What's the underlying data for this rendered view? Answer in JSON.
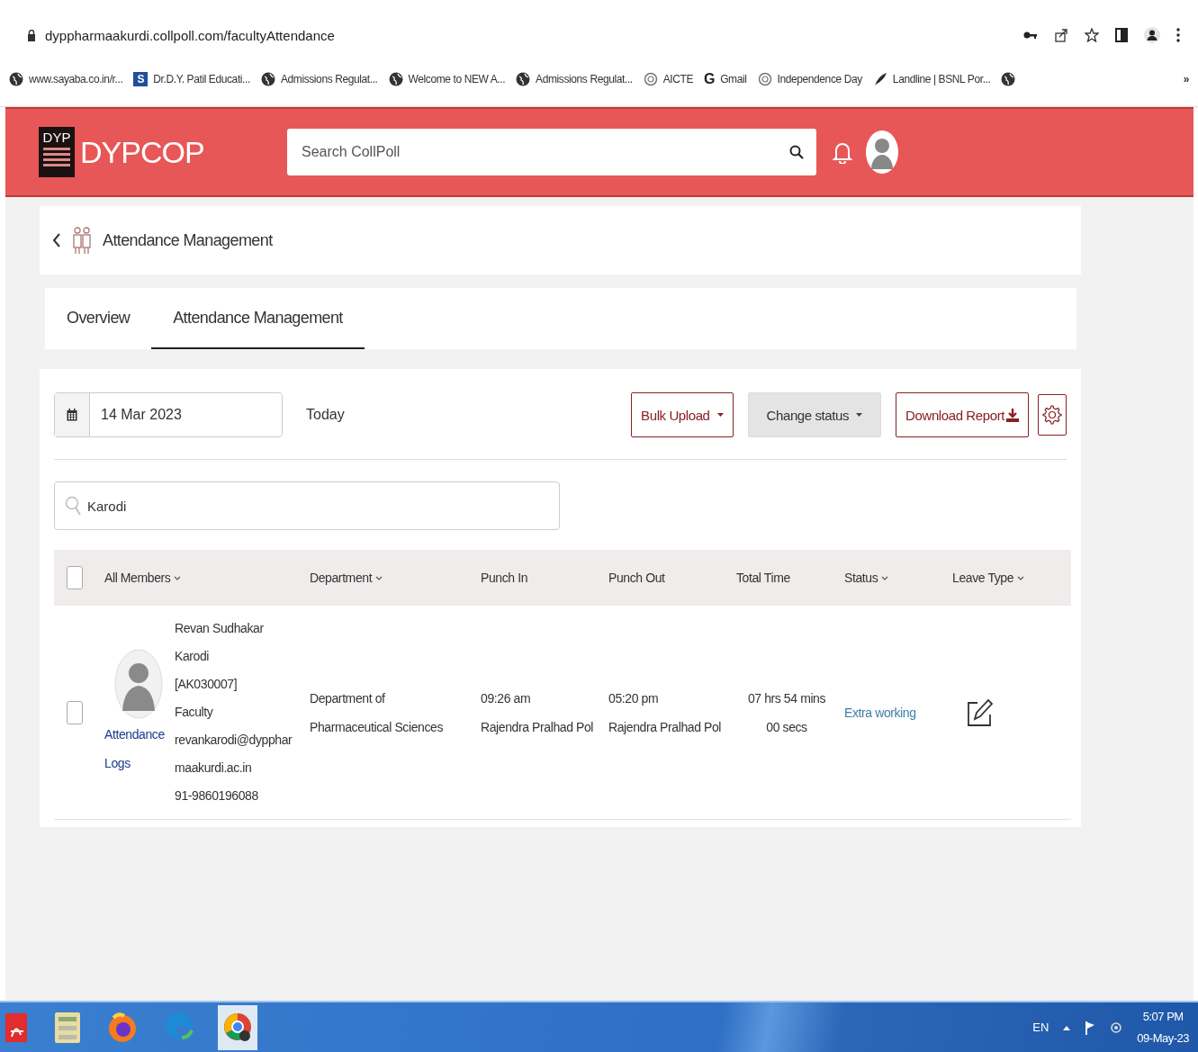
{
  "browser": {
    "url": "dyppharmaakurdi.collpoll.com/facultyAttendance",
    "bookmarks": [
      {
        "label": "www.sayaba.co.in/r...",
        "kind": "globe"
      },
      {
        "label": "Dr.D.Y. Patil Educati...",
        "kind": "letter",
        "letter": "S"
      },
      {
        "label": "Admissions Regulat...",
        "kind": "globe"
      },
      {
        "label": "Welcome to NEW A...",
        "kind": "globe"
      },
      {
        "label": "Admissions Regulat...",
        "kind": "globe"
      },
      {
        "label": "AICTE",
        "kind": "emblem"
      },
      {
        "label": "Gmail",
        "kind": "letter",
        "letter": "G"
      },
      {
        "label": "Independence Day",
        "kind": "emblem"
      },
      {
        "label": "Landline | BSNL Por...",
        "kind": "feather"
      },
      {
        "kind": "globe"
      }
    ],
    "more": "»"
  },
  "header": {
    "logo_text": "DYP",
    "brand": "DYPCOP",
    "search_placeholder": "Search CollPoll"
  },
  "breadcrumb": {
    "title": "Attendance Management"
  },
  "tabs": [
    {
      "label": "Overview",
      "selected": false
    },
    {
      "label": "Attendance Management",
      "selected": true
    }
  ],
  "toolbar": {
    "date": "14 Mar 2023",
    "today": "Today",
    "buttons": [
      {
        "label": "Bulk Upload",
        "kind": "outline-dropdown"
      },
      {
        "label": "Change status",
        "kind": "grey-dropdown"
      },
      {
        "label": "Download Report",
        "kind": "download"
      }
    ]
  },
  "search": {
    "value": "Karodi"
  },
  "table": {
    "select_all": {
      "checked": false
    },
    "columns": [
      {
        "label": "All Members",
        "sortable": true
      },
      {
        "label": "Department",
        "sortable": true
      },
      {
        "label": "Punch In",
        "sortable": false
      },
      {
        "label": "Punch Out",
        "sortable": false
      },
      {
        "label": "Total Time",
        "sortable": false
      },
      {
        "label": "Status",
        "sortable": true
      },
      {
        "label": "Leave Type",
        "sortable": true
      }
    ],
    "rows": [
      {
        "checked": false,
        "logs_link": "Attendance Logs",
        "name": "Revan Sudhakar Karodi",
        "code": "[AK030007]",
        "role": "Faculty",
        "email": "revankarodi@dyppharmaakurdi.ac.in",
        "phone": "91-9860196088",
        "department": "Department of Pharmaceutical Sciences",
        "punch_in": "09:26 am",
        "punch_in_place": "Rajendra Pralhad Pol",
        "punch_out": "05:20 pm",
        "punch_out_place": "Rajendra Pralhad Pol",
        "total_time": "07 hrs 54 mins 00 secs",
        "status": "Extra working"
      }
    ]
  },
  "taskbar": {
    "language": "EN",
    "time": "5:07 PM",
    "date": "09-May-23"
  }
}
